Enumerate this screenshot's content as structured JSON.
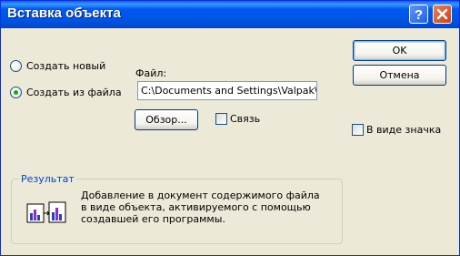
{
  "window": {
    "title": "Вставка объекта"
  },
  "options": {
    "create_new": {
      "label": "Создать новый",
      "selected": false
    },
    "create_from_file": {
      "label": "Создать из файла",
      "selected": true
    }
  },
  "file": {
    "label": "Файл:",
    "value": "C:\\Documents and Settings\\Valpak\\Mo"
  },
  "buttons": {
    "ok": "OK",
    "cancel": "Отмена",
    "browse": "Обзор..."
  },
  "checkboxes": {
    "link": {
      "label": "Связь",
      "checked": false
    },
    "as_icon": {
      "label": "В виде значка",
      "checked": false
    }
  },
  "result": {
    "title": "Результат",
    "lines": [
      "Добавление в документ содержимого файла",
      "в виде объекта, активируемого с помощью",
      "создавшей его программы."
    ]
  },
  "icons": {
    "help": "help-icon",
    "close": "close-icon",
    "result": "embedded-object-icon"
  },
  "colors": {
    "titlebar": "#0054e3",
    "dialog_bg": "#ece9d8",
    "group_title": "#0046d5",
    "close_button": "#c8421e"
  }
}
